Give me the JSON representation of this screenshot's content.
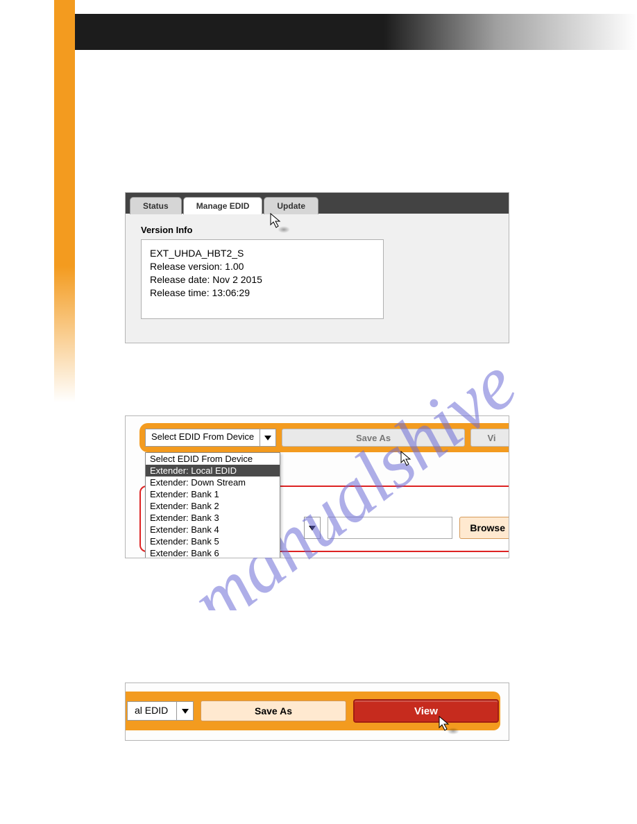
{
  "shot1": {
    "tabs": {
      "status": "Status",
      "manage": "Manage EDID",
      "update": "Update"
    },
    "section_label": "Version Info",
    "info_lines": {
      "l0": "EXT_UHDA_HBT2_S",
      "l1": "Release version: 1.00",
      "l2": "Release date: Nov  2 2015",
      "l3": "Release time: 13:06:29"
    }
  },
  "shot2": {
    "dd_placeholder": "Select EDID From Device",
    "save_as": "Save As",
    "view_partial": "Vi",
    "options": {
      "o0": "Select EDID From Device",
      "o1": "Extender: Local EDID",
      "o2": "Extender: Down Stream",
      "o3": "Extender: Bank 1",
      "o4": "Extender: Bank 2",
      "o5": "Extender: Bank 3",
      "o6": "Extender: Bank 4",
      "o7": "Extender: Bank 5",
      "o8": "Extender: Bank 6"
    },
    "browse": "Browse"
  },
  "shot3": {
    "combo_partial": "al EDID",
    "save_as": "Save As",
    "view": "View"
  }
}
